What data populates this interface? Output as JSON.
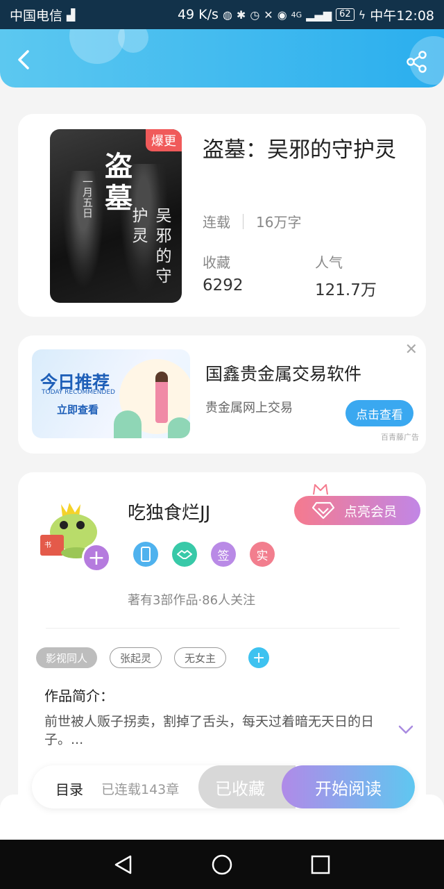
{
  "status_bar": {
    "carrier": "中国电信",
    "speed": "49 K/s",
    "network": "4G",
    "battery": "62",
    "time": "中午12:08"
  },
  "header": {
    "back_icon": "chevron-left-icon",
    "share_icon": "share-icon",
    "accent": "#2aaeee"
  },
  "book": {
    "badge": "爆更",
    "cover_title": "盗墓",
    "cover_subtitle": "吴邪的守护灵",
    "cover_date": "一月五日",
    "title": "盗墓：吴邪的守护灵",
    "status": "连载",
    "word_count": "16万字",
    "favorites_label": "收藏",
    "favorites_value": "6292",
    "popularity_label": "人气",
    "popularity_value": "121.7万"
  },
  "ad": {
    "image_title": "今日推荐",
    "image_subtitle": "TODAY RECOMMENDED",
    "image_cta": "立即查看",
    "title": "国鑫贵金属交易软件",
    "subtitle": "贵金属网上交易",
    "button": "点击查看",
    "source": "百青藤广告",
    "close": "✕"
  },
  "author": {
    "name": "吃独食烂JJ",
    "vip_button": "点亮会员",
    "badges": [
      {
        "icon": "phone-icon",
        "label": "",
        "color": "#4fb2ee"
      },
      {
        "icon": "handshake-icon",
        "label": "",
        "color": "#38c9a8"
      },
      {
        "icon": "sign-badge",
        "label": "签",
        "color": "#b98ae6"
      },
      {
        "icon": "verified-badge",
        "label": "实",
        "color": "#f27e8e"
      }
    ],
    "stats": "著有3部作品·86人关注",
    "tags": [
      "影视同人",
      "张起灵",
      "无女主"
    ],
    "intro_label": "作品简介：",
    "intro_text": "前世被人贩子拐卖，割掉了舌头，每天过着暗无天日的日子。..."
  },
  "action_bar": {
    "toc": "目录",
    "chapter_count": "已连载143章",
    "favorited": "已收藏",
    "start_reading": "开始阅读"
  },
  "nav_bar": {
    "back": "back-triangle-icon",
    "home": "home-circle-icon",
    "recent": "recent-square-icon"
  }
}
